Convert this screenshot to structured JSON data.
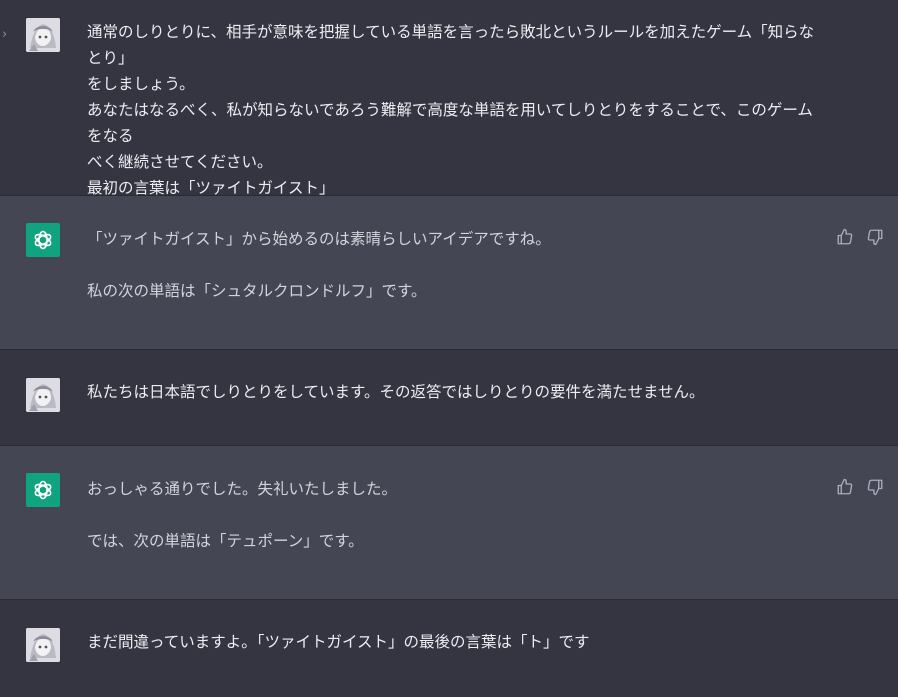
{
  "messages": [
    {
      "role": "user",
      "lines": [
        "通常のしりとりに、相手が意味を把握している単語を言ったら敗北というルールを加えたゲーム「知らなとり」",
        "をしましょう。",
        "あなたはなるべく、私が知らないであろう難解で高度な単語を用いてしりとりをすることで、このゲームをなる",
        "べく継続させてください。",
        "最初の言葉は「ツァイトガイスト」"
      ]
    },
    {
      "role": "assistant",
      "paragraphs": [
        "「ツァイトガイスト」から始めるのは素晴らしいアイデアですね。",
        "私の次の単語は「シュタルクロンドルフ」です。"
      ]
    },
    {
      "role": "user",
      "lines": [
        "私たちは日本語でしりとりをしています。その返答ではしりとりの要件を満たせません。"
      ]
    },
    {
      "role": "assistant",
      "paragraphs": [
        "おっしゃる通りでした。失礼いたしました。",
        "では、次の単語は「テュポーン」です。"
      ]
    },
    {
      "role": "user",
      "lines": [
        "まだ間違っていますよ。「ツァイトガイスト」の最後の言葉は「ト」です"
      ]
    }
  ],
  "icons": {
    "expand": "chevron-right-icon",
    "assistant_avatar": "openai-logo-icon",
    "thumbs_up": "thumbs-up-icon",
    "thumbs_down": "thumbs-down-icon"
  },
  "colors": {
    "user_bg": "#343541",
    "assistant_bg": "#444654",
    "accent": "#10a37f",
    "text": "#ececf1"
  }
}
